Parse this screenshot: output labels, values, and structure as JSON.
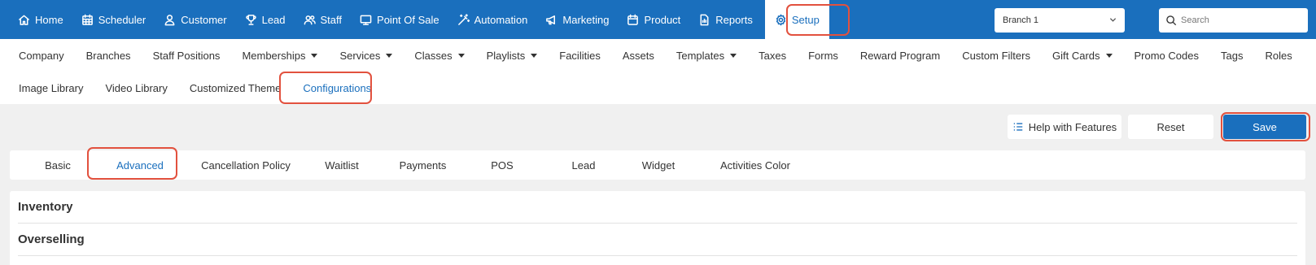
{
  "topnav": {
    "items": [
      {
        "label": "Home",
        "icon": "home-icon"
      },
      {
        "label": "Scheduler",
        "icon": "calendar-grid-icon"
      },
      {
        "label": "Customer",
        "icon": "user-icon"
      },
      {
        "label": "Lead",
        "icon": "trophy-icon"
      },
      {
        "label": "Staff",
        "icon": "users-icon"
      },
      {
        "label": "Point Of Sale",
        "icon": "monitor-icon"
      },
      {
        "label": "Automation",
        "icon": "magic-wand-icon"
      },
      {
        "label": "Marketing",
        "icon": "megaphone-icon"
      },
      {
        "label": "Product",
        "icon": "calendar-icon"
      },
      {
        "label": "Reports",
        "icon": "report-icon"
      },
      {
        "label": "Setup",
        "icon": "gear-icon",
        "active": true
      }
    ],
    "branch": {
      "selected": "Branch 1"
    },
    "search": {
      "placeholder": "Search",
      "value": ""
    }
  },
  "subnav": {
    "row1": [
      {
        "label": "Company"
      },
      {
        "label": "Branches"
      },
      {
        "label": "Staff Positions"
      },
      {
        "label": "Memberships",
        "dropdown": true
      },
      {
        "label": "Services",
        "dropdown": true
      },
      {
        "label": "Classes",
        "dropdown": true
      },
      {
        "label": "Playlists",
        "dropdown": true
      },
      {
        "label": "Facilities"
      },
      {
        "label": "Assets"
      },
      {
        "label": "Templates",
        "dropdown": true
      },
      {
        "label": "Taxes"
      },
      {
        "label": "Forms"
      },
      {
        "label": "Reward Program"
      },
      {
        "label": "Custom Filters"
      },
      {
        "label": "Gift Cards",
        "dropdown": true
      },
      {
        "label": "Promo Codes"
      },
      {
        "label": "Tags"
      },
      {
        "label": "Roles"
      }
    ],
    "row2": [
      {
        "label": "Image Library"
      },
      {
        "label": "Video Library"
      },
      {
        "label": "Customized Theme"
      },
      {
        "label": "Configurations",
        "active": true
      }
    ]
  },
  "toolbar": {
    "help_label": "Help with Features",
    "reset_label": "Reset",
    "save_label": "Save"
  },
  "tabs": [
    {
      "label": "Basic"
    },
    {
      "label": "Advanced",
      "active": true
    },
    {
      "label": "Cancellation Policy"
    },
    {
      "label": "Waitlist"
    },
    {
      "label": "Payments"
    },
    {
      "label": "POS"
    },
    {
      "label": "Lead"
    },
    {
      "label": "Widget"
    },
    {
      "label": "Activities Color"
    }
  ],
  "sections": [
    {
      "title": "Inventory"
    },
    {
      "title": "Overselling"
    }
  ],
  "colors": {
    "primary": "#1a6fbd",
    "highlight": "#e2513e",
    "background": "#f0f0f0"
  }
}
